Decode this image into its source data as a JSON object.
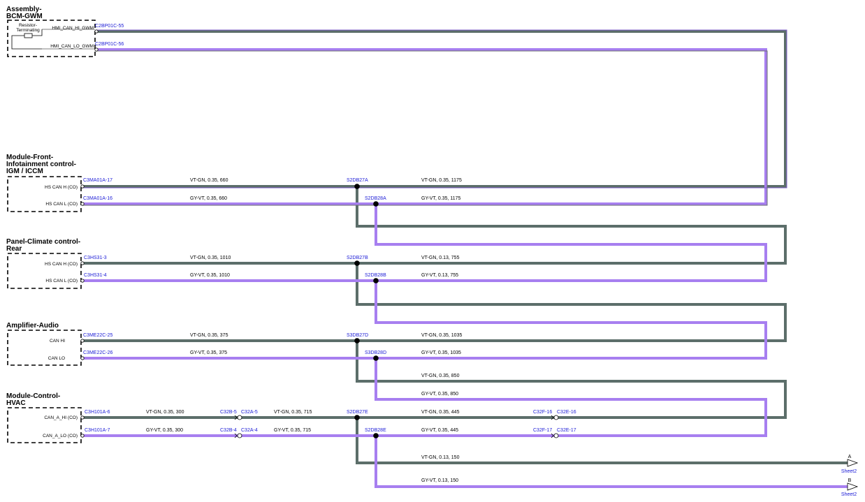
{
  "components": [
    {
      "name": "Assembly-\nBCM-GWM",
      "pins": [
        "HMI_CAN_HI_GWM",
        "HMI_CAN_LO_GWM"
      ],
      "inner": "Resistor-\nTerminating"
    },
    {
      "name": "Module-Front-\nInfotainment control-\nIGM / ICCM",
      "pins": [
        "HS CAN H (CO)",
        "HS CAN L (CO)"
      ]
    },
    {
      "name": "Panel-Climate control-\nRear",
      "pins": [
        "HS CAN H (CO)",
        "HS CAN L (CO)"
      ]
    },
    {
      "name": "Amplifier-Audio",
      "pins": [
        "CAN HI",
        "CAN LO"
      ]
    },
    {
      "name": "Module-Control-\nHVAC",
      "pins": [
        "CAN_A_HI (CO)",
        "CAN_A_LO (CO)"
      ]
    }
  ],
  "connectors": {
    "bcm_hi": "C2BP01C-55",
    "bcm_lo": "C2BP01C-56",
    "igm_hi": "C3MA01A-17",
    "igm_lo": "C3MA01A-16",
    "cc_hi": "C3HS31-3",
    "cc_lo": "C3HS31-4",
    "amp_hi": "C3ME22C-25",
    "amp_lo": "C3ME22C-26",
    "hvac_hi": "C3H101A-6",
    "hvac_lo": "C3H101A-7",
    "inl1_hi_a": "C32B-5",
    "inl1_hi_b": "C32A-5",
    "inl1_lo_a": "C32B-4",
    "inl1_lo_b": "C32A-4",
    "inl2_hi_a": "C32F-16",
    "inl2_hi_b": "C32E-16",
    "inl2_lo_a": "C32F-17",
    "inl2_lo_b": "C32E-17"
  },
  "splices": [
    "S2DB27A",
    "S2DB28A",
    "S2DB27B",
    "S2DB28B",
    "S3DB27D",
    "S3DB28D",
    "S2DB27E",
    "S2DB28E"
  ],
  "wires": {
    "igm_hi_l": "VT-GN,  0.35,  660",
    "igm_hi_r": "VT-GN,  0.35,  1175",
    "igm_lo_l": "GY-VT,  0.35,  660",
    "igm_lo_r": "GY-VT,  0.35,  1175",
    "cc_hi_l": "VT-GN,  0.35,  1010",
    "cc_hi_r": "VT-GN,  0.13,  755",
    "cc_lo_l": "GY-VT,  0.35,  1010",
    "cc_lo_r": "GY-VT,  0.13,  755",
    "amp_hi_l": "VT-GN,  0.35,  375",
    "amp_hi_r": "VT-GN,  0.35,  1035",
    "amp_lo_l": "GY-VT,  0.35,  375",
    "amp_lo_r": "GY-VT,  0.35,  1035",
    "link_hi": "VT-GN,  0.35,  850",
    "link_lo": "GY-VT,  0.35,  850",
    "hvac_hi_1": "VT-GN,  0.35,  300",
    "hvac_hi_2": "VT-GN,  0.35,  715",
    "hvac_hi_3": "VT-GN,  0.35,  445",
    "hvac_lo_1": "GY-VT,  0.35,  300",
    "hvac_lo_2": "GY-VT,  0.35,  715",
    "hvac_lo_3": "GY-VT,  0.35,  445",
    "out_a": "VT-GN,  0.13,  150",
    "out_b": "GY-VT,  0.13,  150"
  },
  "offsheet": {
    "a": "A",
    "b": "B",
    "sheet": "Sheet2"
  },
  "colors": {
    "gy_wire": "#5c6e6a",
    "vt_wire": "#a77ff0",
    "connector_text": "#1a1ad6"
  }
}
